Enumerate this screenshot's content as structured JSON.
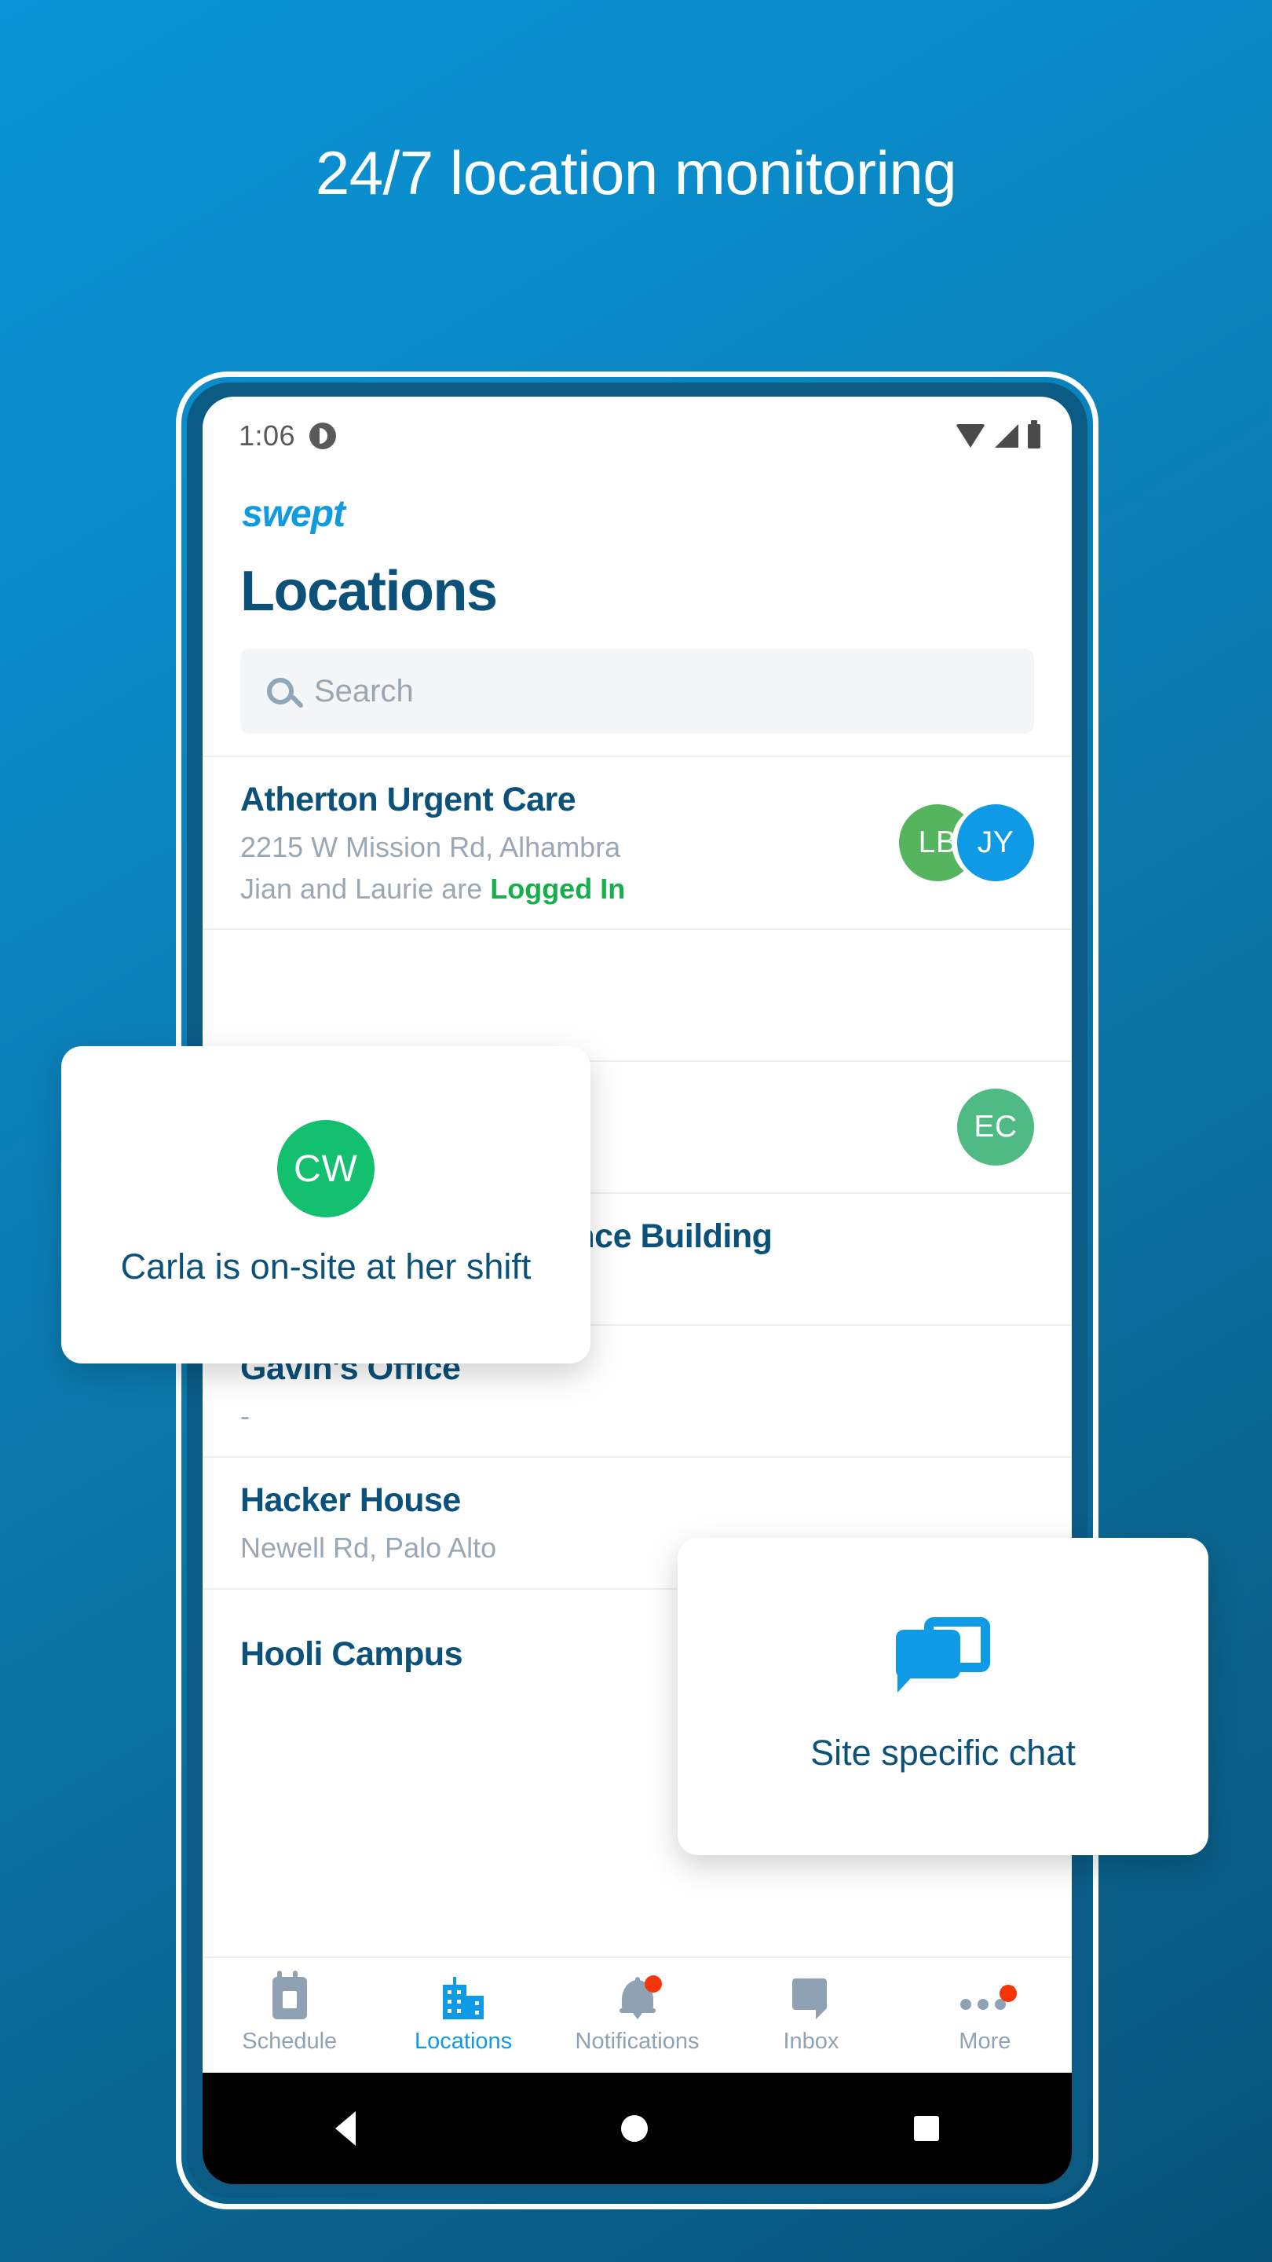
{
  "headline": "24/7 location monitoring",
  "background": {
    "top_color": "#0a93d6",
    "bottom_color": "#075379"
  },
  "phone": {
    "statusbar": {
      "time": "1:06",
      "icons": [
        "app-indicator-icon",
        "wifi-icon",
        "signal-icon",
        "battery-icon"
      ]
    },
    "app": {
      "brand": "swept",
      "page_title": "Locations",
      "search": {
        "placeholder": "Search",
        "value": "",
        "icon": "search-icon"
      },
      "locations": [
        {
          "name": "Atherton Urgent Care",
          "address": "2215 W Mission Rd, Alhambra",
          "status_prefix": "Jian and Laurie are ",
          "status_highlight": "Logged In",
          "avatars": [
            {
              "initials": "LB",
              "color": "#55b55e"
            },
            {
              "initials": "JY",
              "color": "#0e9ae5"
            }
          ]
        },
        {
          "name": "",
          "address": "",
          "status_prefix": "",
          "status_highlight": "",
          "avatars": []
        },
        {
          "name": "",
          "address": "",
          "status_prefix": "",
          "status_highlight": "",
          "avatars": [
            {
              "initials": "EC",
              "color": "#4fba84"
            }
          ]
        },
        {
          "name": "Gates Computer Science Building",
          "address": "-",
          "status_prefix": "",
          "status_highlight": "",
          "avatars": []
        },
        {
          "name": "Gavin's Office",
          "address": "-",
          "status_prefix": "",
          "status_highlight": "",
          "avatars": []
        },
        {
          "name": "Hacker House",
          "address": "Newell Rd, Palo Alto",
          "status_prefix": "",
          "status_highlight": "",
          "avatars": []
        },
        {
          "name": "Hooli Campus",
          "address": "",
          "status_prefix": "",
          "status_highlight": "",
          "avatars": []
        }
      ],
      "tabs": [
        {
          "label": "Schedule",
          "icon": "calendar-icon",
          "active": false,
          "badge": false
        },
        {
          "label": "Locations",
          "icon": "building-icon",
          "active": true,
          "badge": false
        },
        {
          "label": "Notifications",
          "icon": "bell-icon",
          "active": false,
          "badge": true
        },
        {
          "label": "Inbox",
          "icon": "chat-bubble-icon",
          "active": false,
          "badge": false
        },
        {
          "label": "More",
          "icon": "ellipsis-icon",
          "active": false,
          "badge": true
        }
      ],
      "active_tab_color": "#0e9ae5",
      "inactive_tab_color": "#8fa2b4",
      "badge_color": "#f7350a"
    },
    "android_nav": [
      "back-button",
      "home-button",
      "recents-button"
    ]
  },
  "tooltips": {
    "onsite": {
      "avatar_initials": "CW",
      "avatar_color": "#13c06f",
      "text": "Carla is on-site at her shift"
    },
    "chat": {
      "icon": "double-chat-bubble-icon",
      "icon_color": "#0e9ae5",
      "text": "Site specific chat"
    }
  }
}
